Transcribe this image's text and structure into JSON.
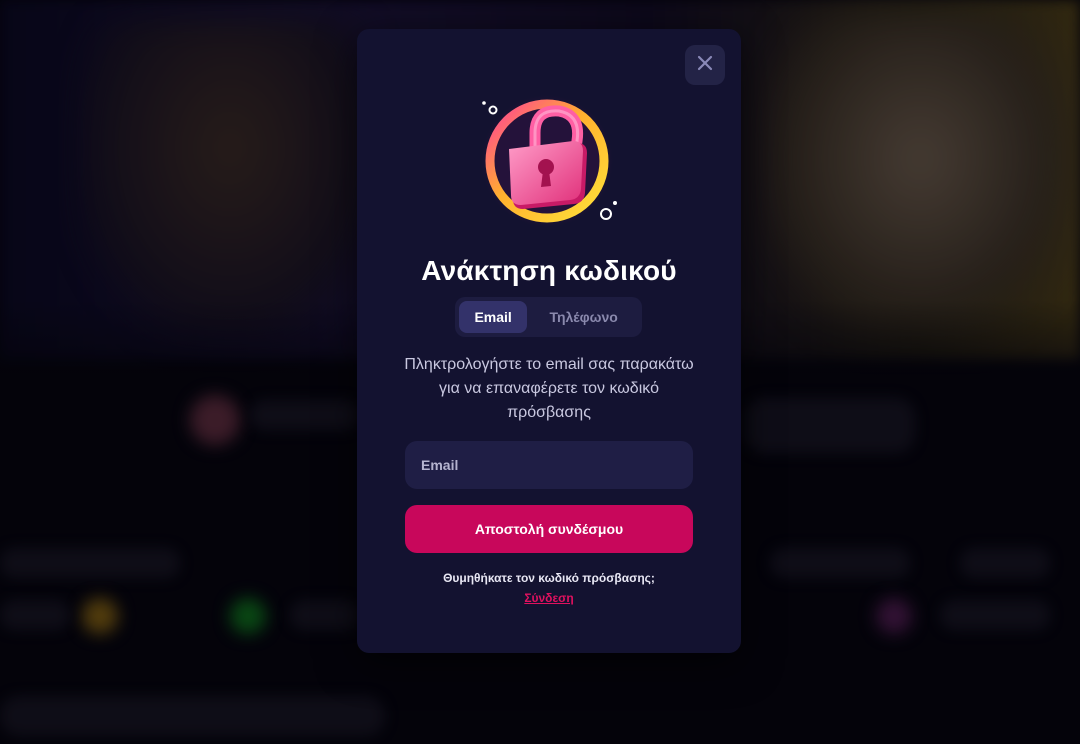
{
  "modal": {
    "title": "Ανάκτηση κωδικού",
    "tabs": [
      {
        "label": "Email",
        "active": true
      },
      {
        "label": "Τηλέφωνο",
        "active": false
      }
    ],
    "description": "Πληκτρολογήστε το email σας παρακάτω για να επαναφέρετε τον κωδικό πρόσβασης",
    "email_input": {
      "placeholder": "Email",
      "value": ""
    },
    "submit_label": "Αποστολή συνδέσμου",
    "remember_text": "Θυμηθήκατε τον κωδικό πρόσβασης;",
    "login_link": "Σύνδεση",
    "close_icon": "close-icon",
    "illustration": "padlock-icon"
  },
  "colors": {
    "modal_bg": "#131230",
    "accent": "#c8075b",
    "link": "#e0115f",
    "tab_active": "#33326a",
    "input_bg": "#1f1e45"
  }
}
